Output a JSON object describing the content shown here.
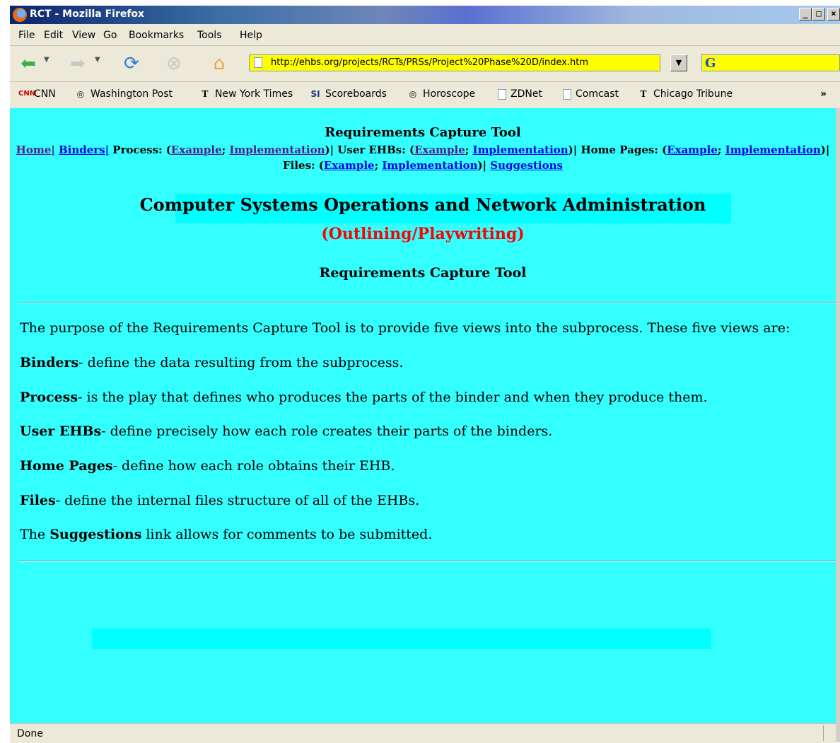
{
  "window": {
    "title": "RCT - Mozilla Firefox",
    "minimize": "_",
    "maximize": "□",
    "close": "×"
  },
  "menu": [
    "File",
    "Edit",
    "View",
    "Go",
    "Bookmarks",
    "Tools",
    "Help"
  ],
  "navigation": {
    "url": "http://ehbs.org/projects/RCTs/PRSs/Project%20Phase%20D/index.htm",
    "search_value": ""
  },
  "bookmarks": [
    "CNN",
    "Washington Post",
    "New York Times",
    "Scoreboards",
    "Horoscope",
    "ZDNet",
    "Comcast",
    "Chicago Tribune"
  ],
  "bookmarks_overflow": "»",
  "page": {
    "header_title": "Requirements Capture Tool",
    "links": {
      "home": "Home|",
      "binders": "Binders|",
      "process_label": "Process: (",
      "example": "Example",
      "semicolon": "; ",
      "implementation": "Implementation",
      "close_sep": ")| ",
      "user_ehbs_label": "User EHBs: (",
      "home_pages_label": "Home Pages: (",
      "files_label": "Files: (",
      "suggestions": "Suggestions"
    },
    "main_title": "Computer Systems Operations and Network Administration",
    "subtitle": "(Outlining/Playwriting)",
    "section_title": "Requirements Capture Tool",
    "intro": "The purpose of the Requirements Capture Tool is to provide five views into the subprocess. These five views are:",
    "views": [
      {
        "term": "Binders",
        "desc": "- define the data resulting from the subprocess."
      },
      {
        "term": "Process",
        "desc": "- is the play that defines who produces the parts of the binder and when they produce them."
      },
      {
        "term": "User EHBs",
        "desc": "- define precisely how each role creates their parts of the binders."
      },
      {
        "term": "Home Pages",
        "desc": "- define how each role obtains their EHB."
      },
      {
        "term": "Files",
        "desc": "- define the internal files structure of all of the EHBs."
      }
    ],
    "suggestions_pre": "The ",
    "suggestions_term": "Suggestions",
    "suggestions_post": " link allows for comments to be submitted."
  },
  "status": "Done"
}
